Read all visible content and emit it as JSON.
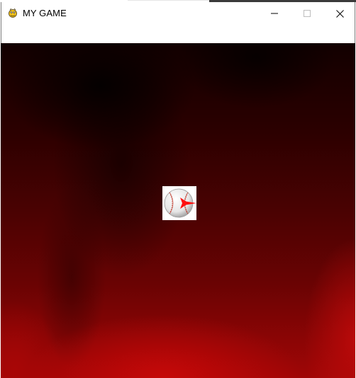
{
  "window": {
    "title": "MY GAME",
    "icon": "pygame-snake-icon",
    "controls": {
      "minimize": "minimize-icon",
      "maximize": "maximize-icon",
      "close": "close-icon"
    }
  },
  "game": {
    "background": "red-flame-background",
    "sprite": {
      "icon": "baseball-with-red-arrow-icon",
      "ball_color": "#f4f4f4",
      "stitch_color": "#c0392b",
      "arrow_color": "#ff1010"
    }
  }
}
